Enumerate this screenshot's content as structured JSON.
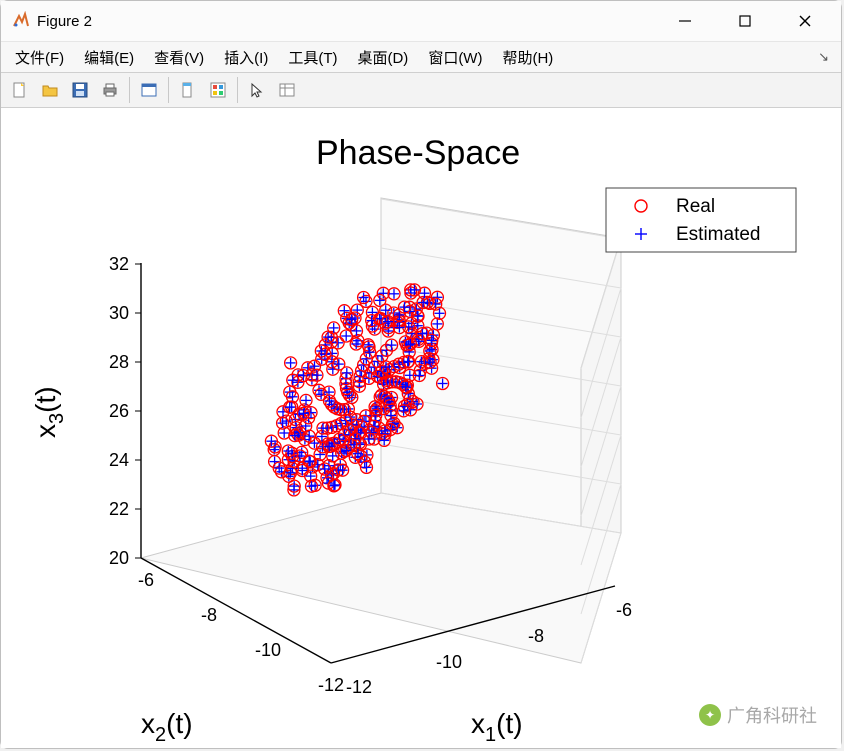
{
  "window": {
    "title": "Figure 2"
  },
  "menu": {
    "file": "文件(F)",
    "edit": "编辑(E)",
    "view": "查看(V)",
    "insert": "插入(I)",
    "tools": "工具(T)",
    "desktop": "桌面(D)",
    "window_menu": "窗口(W)",
    "help": "帮助(H)"
  },
  "toolbar_icons": {
    "new": "new-file-icon",
    "open": "open-folder-icon",
    "save": "save-icon",
    "print": "print-icon",
    "figure": "figure-icon",
    "datacursor": "data-cursor-icon",
    "colorbar": "colorbar-icon",
    "legend": "legend-icon",
    "pointer": "pointer-icon",
    "propedit": "property-editor-icon"
  },
  "legend": {
    "items": [
      {
        "marker": "o",
        "color": "#ff0000",
        "label": "Real"
      },
      {
        "marker": "+",
        "color": "#0000ff",
        "label": "Estimated"
      }
    ]
  },
  "chart_data": {
    "type": "scatter",
    "title": "Phase-Space",
    "xlabel": "x₁(t)",
    "ylabel": "x₂(t)",
    "zlabel": "x₃(t)",
    "xrange": [
      -12,
      -6
    ],
    "yrange": [
      -12,
      -6
    ],
    "zrange": [
      20,
      32
    ],
    "xticks": [
      -12,
      -10,
      -8,
      -6
    ],
    "yticks": [
      -12,
      -10,
      -8,
      -6
    ],
    "zticks": [
      20,
      22,
      24,
      26,
      28,
      30,
      32
    ],
    "series": [
      {
        "name": "Real",
        "marker": "o",
        "color": "#ff0000",
        "note": "Observed trajectory; ring-shaped cluster roughly centered near x1≈-9, x2≈-9, x3≈26, spanning approx x1∈[-11,-7], x2∈[-11,-7], x3∈[22,31]."
      },
      {
        "name": "Estimated",
        "marker": "+",
        "color": "#0000ff",
        "note": "Model-estimated trajectory overlaid on Real points (tightly matching)."
      }
    ]
  },
  "watermark": {
    "text": "广角科研社"
  },
  "axis_text": {
    "title": "Phase-Space",
    "x1": "x",
    "x1_sub": "1",
    "x1_tail": "(t)",
    "x2": "x",
    "x2_sub": "2",
    "x2_tail": "(t)",
    "x3": "x",
    "x3_sub": "3",
    "x3_tail": "(t)",
    "zt": {
      "t20": "20",
      "t22": "22",
      "t24": "24",
      "t26": "26",
      "t28": "28",
      "t30": "30",
      "t32": "32"
    },
    "yt": {
      "m6": "-6",
      "m8": "-8",
      "m10": "-10",
      "m12": "-12"
    },
    "xt": {
      "m6": "-6",
      "m8": "-8",
      "m10": "-10",
      "m12": "-12"
    }
  }
}
